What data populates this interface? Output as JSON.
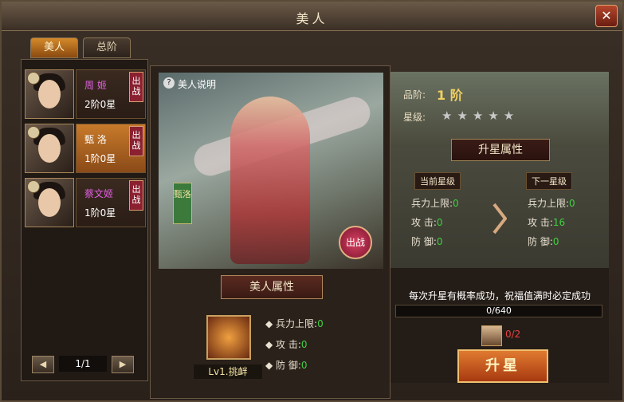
{
  "window": {
    "title": "美人",
    "close_label": "✕"
  },
  "tabs": [
    {
      "label": "美人",
      "active": true
    },
    {
      "label": "总阶",
      "active": false
    }
  ],
  "beauties": [
    {
      "name": "周 姬",
      "level": "2阶0星",
      "action": "出战",
      "selected": false
    },
    {
      "name": "甄 洛",
      "level": "1阶0星",
      "action": "出战",
      "selected": true
    },
    {
      "name": "蔡文姬",
      "level": "1阶0星",
      "action": "出战",
      "selected": false
    }
  ],
  "pager": {
    "prev": "◀",
    "next": "▶",
    "page": "1/1"
  },
  "center": {
    "help_icon": "?",
    "help_label": "美人说明",
    "vertical_name": "甄洛",
    "battle_label": "出战",
    "attr_header": "美人属性",
    "skill_label": "Lv1.挑衅",
    "stats": [
      {
        "label": "兵力上限:",
        "value": "0"
      },
      {
        "label": "攻      击:",
        "value": "0"
      },
      {
        "label": "防      御:",
        "value": "0"
      }
    ]
  },
  "right": {
    "grade_label": "品阶:",
    "grade_value": "1 阶",
    "star_label": "星级:",
    "stars_filled": 0,
    "stars_total": 5,
    "upgrade_header": "升星属性",
    "current_label": "当前星级",
    "next_label": "下一星级",
    "current_stats": [
      {
        "label": "兵力上限:",
        "value": "0"
      },
      {
        "label": "攻      击:",
        "value": "0"
      },
      {
        "label": "防      御:",
        "value": "0"
      }
    ],
    "next_stats": [
      {
        "label": "兵力上限:",
        "value": "0"
      },
      {
        "label": "攻      击:",
        "value": "16"
      },
      {
        "label": "防      御:",
        "value": "0"
      }
    ],
    "note": "每次升星有概率成功，祝福值满时必定成功",
    "progress_text": "0/640",
    "progress_fraction": 0,
    "item_count": "0/2",
    "upgrade_button": "升星"
  },
  "colors": {
    "accent": "#c87a2a",
    "green_value": "#40d040",
    "red_count": "#e84040",
    "name_purple": "#e060e0"
  }
}
